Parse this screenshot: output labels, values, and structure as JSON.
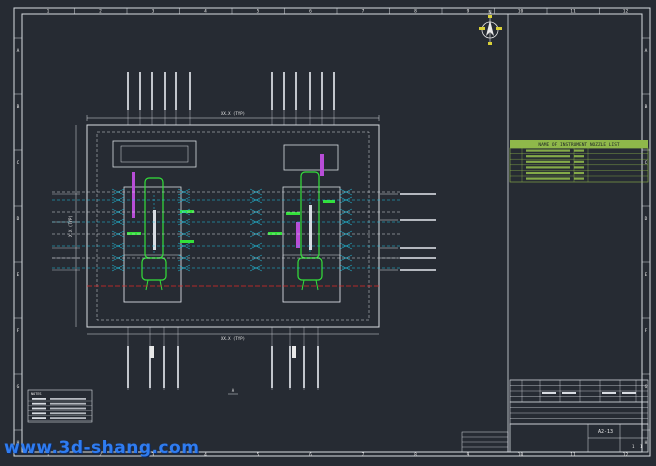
{
  "drawing": {
    "column_numbers": [
      "1",
      "2",
      "3",
      "4",
      "5",
      "6",
      "7",
      "8",
      "9",
      "10",
      "11",
      "12"
    ],
    "row_letters": [
      "A",
      "B",
      "C",
      "D",
      "E",
      "F",
      "G",
      "H"
    ],
    "colors": {
      "background": "#262b33",
      "frame": "#d8dce2",
      "green": "#33e03a",
      "cyan": "#20c8e8",
      "magenta": "#b84dd8",
      "red": "#e02828",
      "yellow": "#d8d038",
      "table_green": "#8fb84a"
    },
    "north_symbol": "N",
    "watermark": "www.3d-shang.com"
  },
  "plan": {
    "top_dimension": "XX.X (TYP)",
    "bottom_dimension": "XX.X (TYP)",
    "left_dimension": "X.X (TYP)",
    "section_mark": "A"
  },
  "nozzle_table": {
    "title": "NAME OF INSTRUMENT NOZZLE LIST"
  },
  "title_block": {
    "drawing_no": "A2-13",
    "sheet": "1",
    "of": "1"
  },
  "legend_box": {
    "heading": "NOTES"
  }
}
